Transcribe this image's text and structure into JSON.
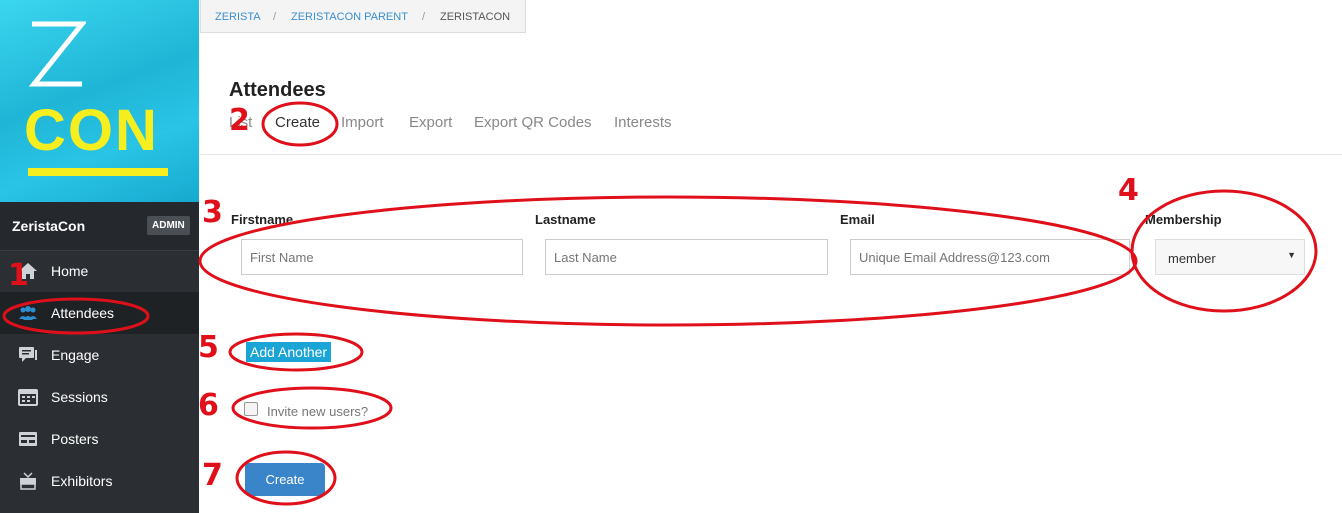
{
  "sidebar": {
    "logo": {
      "line1": "Z",
      "line2": "CON"
    },
    "org_name": "ZeristaCon",
    "role_badge": "ADMIN",
    "items": [
      {
        "label": "Home",
        "icon": "home-icon"
      },
      {
        "label": "Attendees",
        "icon": "users-icon",
        "active": true
      },
      {
        "label": "Engage",
        "icon": "chat-icon"
      },
      {
        "label": "Sessions",
        "icon": "calendar-icon"
      },
      {
        "label": "Posters",
        "icon": "poster-icon"
      },
      {
        "label": "Exhibitors",
        "icon": "exhibitor-icon"
      }
    ]
  },
  "breadcrumb": {
    "items": [
      "ZERISTA",
      "ZERISTACON PARENT",
      "ZERISTACON"
    ],
    "separator": "/"
  },
  "page": {
    "title": "Attendees",
    "tabs": [
      "List",
      "Create",
      "Import",
      "Export",
      "Export QR Codes",
      "Interests"
    ],
    "active_tab": "Create"
  },
  "form": {
    "firstname": {
      "label": "Firstname",
      "placeholder": "First Name"
    },
    "lastname": {
      "label": "Lastname",
      "placeholder": "Last Name"
    },
    "email": {
      "label": "Email",
      "placeholder": "Unique Email Address@123.com"
    },
    "membership": {
      "label": "Membership",
      "value": "member"
    },
    "add_another": "Add Another",
    "invite_label": "Invite new users?",
    "invite_checked": false,
    "submit": "Create"
  },
  "annotations": [
    "1",
    "2",
    "3",
    "4",
    "5",
    "6",
    "7"
  ],
  "colors": {
    "sidebar_bg": "#2b2e33",
    "logo_bg": "#29c4e6",
    "logo_text": "#f6ee1f",
    "link": "#3a8fd0",
    "add_button": "#1aa5d6",
    "create_button": "#3a85c9",
    "annotation": "#e0101b"
  }
}
